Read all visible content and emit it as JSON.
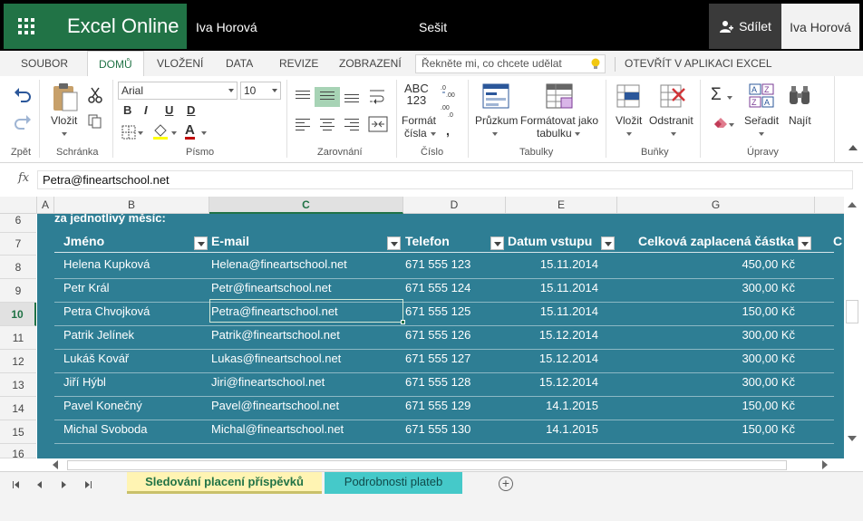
{
  "titlebar": {
    "app_name": "Excel Online",
    "user_name": "Iva Horová",
    "document_name": "Sešit",
    "share_label": "Sdílet",
    "user_panel": "Iva Horová",
    "accent_color": "#217346"
  },
  "tabs": [
    {
      "label": "SOUBOR"
    },
    {
      "label": "DOMŮ"
    },
    {
      "label": "VLOŽENÍ"
    },
    {
      "label": "DATA"
    },
    {
      "label": "REVIZE"
    },
    {
      "label": "ZOBRAZENÍ"
    }
  ],
  "tell_me_placeholder": "Řekněte mi, co chcete udělat",
  "open_in_app": "OTEVŘÍT V APLIKACI EXCEL",
  "ribbon": {
    "groups": {
      "undo": "Zpět",
      "clipboard": "Schránka",
      "font": "Písmo",
      "alignment": "Zarovnání",
      "number": "Číslo",
      "tables": "Tabulky",
      "cells": "Buňky",
      "editing": "Úpravy"
    },
    "paste": "Vložit",
    "font_name": "Arial",
    "font_size": "10",
    "bold": "B",
    "italic": "I",
    "underline": "U",
    "double_underline": "D",
    "font_color_letter": "A",
    "number_format_icon": "ABC\n123",
    "number_format_line1": "Formát",
    "number_format_line2": "čísla",
    "survey": "Průzkum",
    "format_table_line1": "Formátovat jako",
    "format_table_line2": "tabulku",
    "insert_cells": "Vložit",
    "delete_cells": "Odstranit",
    "sort": "Seřadit",
    "find": "Najít",
    "sigma": "Σ"
  },
  "formula_bar": {
    "fx": "fx",
    "value": "Petra@fineartschool.net"
  },
  "columns": [
    "A",
    "B",
    "C",
    "D",
    "E",
    "G"
  ],
  "rows": [
    "6",
    "7",
    "8",
    "9",
    "10",
    "11",
    "12",
    "13",
    "14",
    "15",
    "16"
  ],
  "sheet": {
    "top_text": "za jednotlivý měsíc:",
    "headers": [
      "Jméno",
      "E-mail",
      "Telefon",
      "Datum vstupu",
      "Celková zaplacená částka",
      "C"
    ],
    "records": [
      {
        "name": "Helena Kupková",
        "email": "Helena@fineartschool.net",
        "phone": "671 555 123",
        "date": "15.11.2014",
        "amount": "450,00 Kč"
      },
      {
        "name": "Petr Král",
        "email": "Petr@fineartschool.net",
        "phone": "671 555 124",
        "date": "15.11.2014",
        "amount": "300,00 Kč"
      },
      {
        "name": "Petra Chvojková",
        "email": "Petra@fineartschool.net",
        "phone": "671 555 125",
        "date": "15.11.2014",
        "amount": "150,00 Kč"
      },
      {
        "name": "Patrik Jelínek",
        "email": "Patrik@fineartschool.net",
        "phone": "671 555 126",
        "date": "15.12.2014",
        "amount": "300,00 Kč"
      },
      {
        "name": "Lukáš Kovář",
        "email": "Lukas@fineartschool.net",
        "phone": "671 555 127",
        "date": "15.12.2014",
        "amount": "300,00 Kč"
      },
      {
        "name": "Jiří Hýbl",
        "email": "Jiri@fineartschool.net",
        "phone": "671 555 128",
        "date": "15.12.2014",
        "amount": "300,00 Kč"
      },
      {
        "name": "Pavel Konečný",
        "email": "Pavel@fineartschool.net",
        "phone": "671 555 129",
        "date": "14.1.2015",
        "amount": "150,00 Kč"
      },
      {
        "name": "Michal Svoboda",
        "email": "Michal@fineartschool.net",
        "phone": "671 555 130",
        "date": "14.1.2015",
        "amount": "150,00 Kč"
      }
    ],
    "active_cell": "C10",
    "fill_color": "#2e7e94"
  },
  "sheet_tabs": [
    {
      "label": "Sledování placení příspěvků"
    },
    {
      "label": "Podrobnosti plateb"
    }
  ],
  "add_sheet": "+"
}
